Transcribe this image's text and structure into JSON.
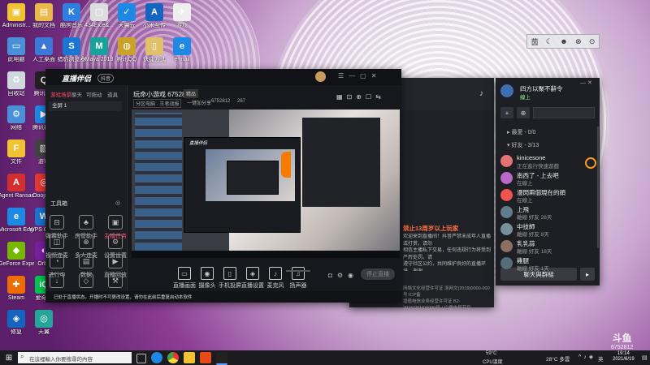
{
  "desktop": {
    "icons": [
      {
        "label": "Administr...",
        "color": "#f1c232",
        "glyph": "▣"
      },
      {
        "label": "我的文档",
        "color": "#e9b949",
        "glyph": "▤"
      },
      {
        "label": "酷狗音乐",
        "color": "#2f7fe0",
        "glyph": "K"
      },
      {
        "label": "434Eice&...",
        "color": "#dddddd",
        "glyph": "▢"
      },
      {
        "label": "天翼云",
        "color": "#1e88e5",
        "glyph": "✓"
      },
      {
        "label": "小米互传",
        "color": "#1565c0",
        "glyph": "A"
      },
      {
        "label": "游戏",
        "color": "#eeeeee",
        "glyph": "✈"
      },
      {
        "label": "此电脑",
        "color": "#4a90d9",
        "glyph": "▭"
      },
      {
        "label": "人工桌面",
        "color": "#3b78d8",
        "glyph": "▲"
      },
      {
        "label": "猎豹浏览器",
        "color": "#1976d2",
        "glyph": "S"
      },
      {
        "label": "Maya 2018",
        "color": "#18a39a",
        "glyph": "M"
      },
      {
        "label": "腾讯QQ",
        "color": "#c9a227",
        "glyph": "◍"
      },
      {
        "label": "快捷方式",
        "color": "#e0c16a",
        "glyph": "▯"
      },
      {
        "label": "e-mail",
        "color": "#1e88e5",
        "glyph": "e"
      },
      {
        "label": "回收站",
        "color": "#cfd8dc",
        "glyph": "♻"
      },
      {
        "label": "腾讯QQ",
        "color": "#222222",
        "glyph": "Q"
      },
      {
        "label": "网络",
        "color": "#4a90d9",
        "glyph": "⚙"
      },
      {
        "label": "腾讯视频",
        "color": "#1e88e5",
        "glyph": "▶"
      },
      {
        "label": "文件",
        "color": "#f1c232",
        "glyph": "F"
      },
      {
        "label": "游戏",
        "color": "#444444",
        "glyph": "▧"
      },
      {
        "label": "Agent Ransack",
        "color": "#d32f2f",
        "glyph": "A"
      },
      {
        "label": "Ooojstr...",
        "color": "#e53935",
        "glyph": "◎"
      },
      {
        "label": "Microsoft Edge",
        "color": "#1e88e5",
        "glyph": "e"
      },
      {
        "label": "WPS Office",
        "color": "#1976d2",
        "glyph": "W"
      },
      {
        "label": "GeForce Experience",
        "color": "#76b900",
        "glyph": "◆"
      },
      {
        "label": "Orbit",
        "color": "#7b1fa2",
        "glyph": "◐"
      },
      {
        "label": "Steam",
        "color": "#ef6c00",
        "glyph": "✚"
      },
      {
        "label": "爱奇艺",
        "color": "#00c853",
        "glyph": "iQ"
      },
      {
        "label": "修复",
        "color": "#1565c0",
        "glyph": "◈"
      },
      {
        "label": "天翼",
        "color": "#26a69a",
        "glyph": "◎"
      }
    ]
  },
  "overlay_toolbar": {
    "items": [
      "茵",
      "☾",
      "☻",
      "⊗",
      "⊙"
    ]
  },
  "obs": {
    "logo": "直播伴侣",
    "badge": "抖音",
    "left_tabs": [
      "游戏场景",
      "聊天",
      "可拖动",
      "道具"
    ],
    "source_item": "全屏 1",
    "tools_title": "工具箱",
    "tools": [
      {
        "label": "弹幕助手",
        "glyph": "⊟"
      },
      {
        "label": "房管助手",
        "glyph": "♣"
      },
      {
        "label": "主播任务",
        "glyph": "▣"
      },
      {
        "label": "视频连麦",
        "glyph": "◫"
      },
      {
        "label": "多人连麦",
        "glyph": "⊕"
      },
      {
        "label": "设置设置",
        "glyph": "⚙"
      },
      {
        "label": "进行中",
        "glyph": "◔"
      },
      {
        "label": "数据",
        "glyph": "▤"
      },
      {
        "label": "直播回放",
        "glyph": "▶"
      },
      {
        "label": "回车提醒",
        "glyph": "↓"
      },
      {
        "label": "画质",
        "glyph": "◇"
      },
      {
        "label": "高级",
        "glyph": "⚒"
      }
    ],
    "status_text": "已处于直播状态。开播时不可更改设置，请勿在此前后重复启动本软件",
    "room_title": "玩命小游戏 6752812",
    "room_tag": "精品",
    "sub_tags": [
      "分区电脑 · 王者战报",
      "一键加分享",
      "6752812",
      "267"
    ],
    "controls": [
      {
        "label": "直播画面",
        "glyph": "▭"
      },
      {
        "label": "摄像头",
        "glyph": "◉"
      },
      {
        "label": "手机投屏",
        "glyph": "▯"
      },
      {
        "label": "直播设置",
        "glyph": "◈"
      },
      {
        "label": "麦克风",
        "glyph": "♪"
      },
      {
        "label": "扬声器",
        "glyph": "♫"
      }
    ],
    "start_button": "停止直播",
    "inner_title": "直播伴侣"
  },
  "chat_panel": {
    "title": "禁止13周岁以上玩家",
    "lines": [
      "欢迎来到直播间！抖音严禁未成年人直播或打赏，请勿",
      "相信主播私下交易，任何违规行为将受到严厉处罚。请",
      "遵守社区公约，共同维护良好的直播环境，谢谢。",
      "若遇到违规内容请及时举报，平台将及时处理。"
    ],
    "footer_lines": [
      "网络文化经营许可证 浙网文(2019)0000-000号 ICP备",
      "增值电信业务经营许可证 B2-2016(2016)0000号 / 广播电视节目",
      "制作经营许可证 (浙)字第00000号 © 2018 杭州抖音科技有限公司"
    ]
  },
  "friends": {
    "user_name": "四方以聚不辭令",
    "user_status": "線上",
    "search_placeholder": "",
    "section_favorites": "▸ 最愛 - 0/0",
    "section_friends": "▾ 好友 - 3/13",
    "list": [
      {
        "name": "kinicesone",
        "status": "正在進行快速遊戲",
        "color": "#e57373"
      },
      {
        "name": "南西了 - 上去吧",
        "status": "在線上",
        "color": "#ba68c8"
      },
      {
        "name": "漫閃兩個現在的頭",
        "status": "在線上",
        "color": "#ef5350"
      },
      {
        "name": "上飛",
        "status": "離線 好友 26天",
        "color": "#607d8b"
      },
      {
        "name": "中技師",
        "status": "離線 好友 8天",
        "color": "#78909c"
      },
      {
        "name": "乳乳蒜",
        "status": "離線 好友 18天",
        "color": "#8d6e63"
      },
      {
        "name": "雞腿",
        "status": "離線 好友 1天",
        "color": "#546e7a"
      }
    ],
    "group_chat_button": "聊天與群組",
    "collapse_glyph": "▸"
  },
  "watermark": {
    "brand": "斗鱼",
    "room": "6752812"
  },
  "taskbar": {
    "search_placeholder": "在這裡輸入你要搜尋的內容",
    "weather": "28°C 多雲",
    "cpu": "CPU溫度",
    "temp": "59°C",
    "time": "19:14",
    "date": "2021/6/19",
    "ime": "英"
  }
}
